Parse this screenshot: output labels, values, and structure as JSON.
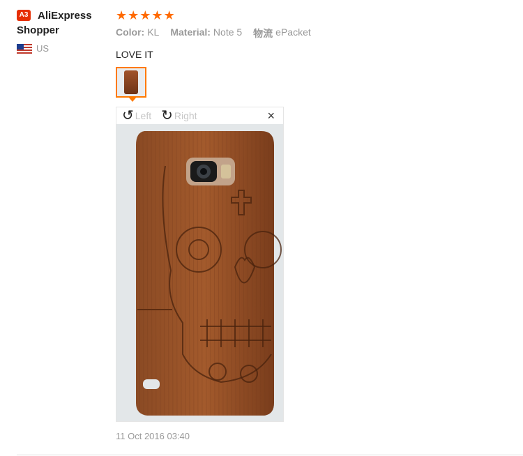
{
  "user": {
    "badge": "A3",
    "name_line1": "AliExpress",
    "name_line2": "Shopper",
    "country": "US"
  },
  "review": {
    "stars": 5,
    "star_glyph": "★",
    "attributes": [
      {
        "key": "Color:",
        "value": "KL"
      },
      {
        "key": "Material:",
        "value": "Note 5"
      },
      {
        "key": "物流",
        "value": "ePacket"
      }
    ],
    "content": "LOVE IT",
    "date": "11 Oct 2016 03:40"
  },
  "viewer": {
    "rotate_left_label": "Left",
    "rotate_right_label": "Right",
    "close_glyph": "×"
  },
  "colors": {
    "star": "#ff6a00",
    "thumb_border": "#ff7a00",
    "badge": "#e62e04"
  }
}
